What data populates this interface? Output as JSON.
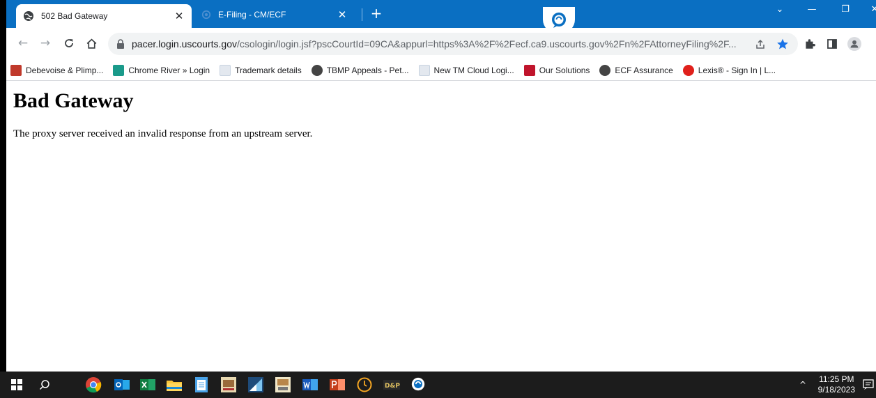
{
  "browser": {
    "tabs": [
      {
        "title": "502 Bad Gateway",
        "active": true
      },
      {
        "title": "E-Filing - CM/ECF",
        "active": false
      }
    ],
    "address": {
      "host": "pacer.login.uscourts.gov",
      "path": "/csologin/login.jsf?pscCourtId=09CA&appurl=https%3A%2F%2Fecf.ca9.uscourts.gov%2Fn%2FAttorneyFiling%2F..."
    },
    "bookmarks": [
      {
        "label": "Debevoise & Plimp...",
        "color": "#c0392b"
      },
      {
        "label": "Chrome River » Login",
        "color": "#1a9a8a"
      },
      {
        "label": "Trademark details",
        "color": "#c8d3e0"
      },
      {
        "label": "TBMP Appeals - Pet...",
        "color": "#444444"
      },
      {
        "label": "New TM Cloud Logi...",
        "color": "#c8d3e0"
      },
      {
        "label": "Our Solutions",
        "color": "#c0142c"
      },
      {
        "label": "ECF Assurance",
        "color": "#444444"
      },
      {
        "label": "Lexis® - Sign In | L...",
        "color": "#e0201b"
      }
    ]
  },
  "page": {
    "heading": "Bad Gateway",
    "message": "The proxy server received an invalid response from an upstream server."
  },
  "taskbar": {
    "time": "11:25 PM",
    "date": "9/18/2023"
  },
  "colors": {
    "tabbar": "#0a6fc2",
    "taskbar": "#1c1c1c"
  }
}
